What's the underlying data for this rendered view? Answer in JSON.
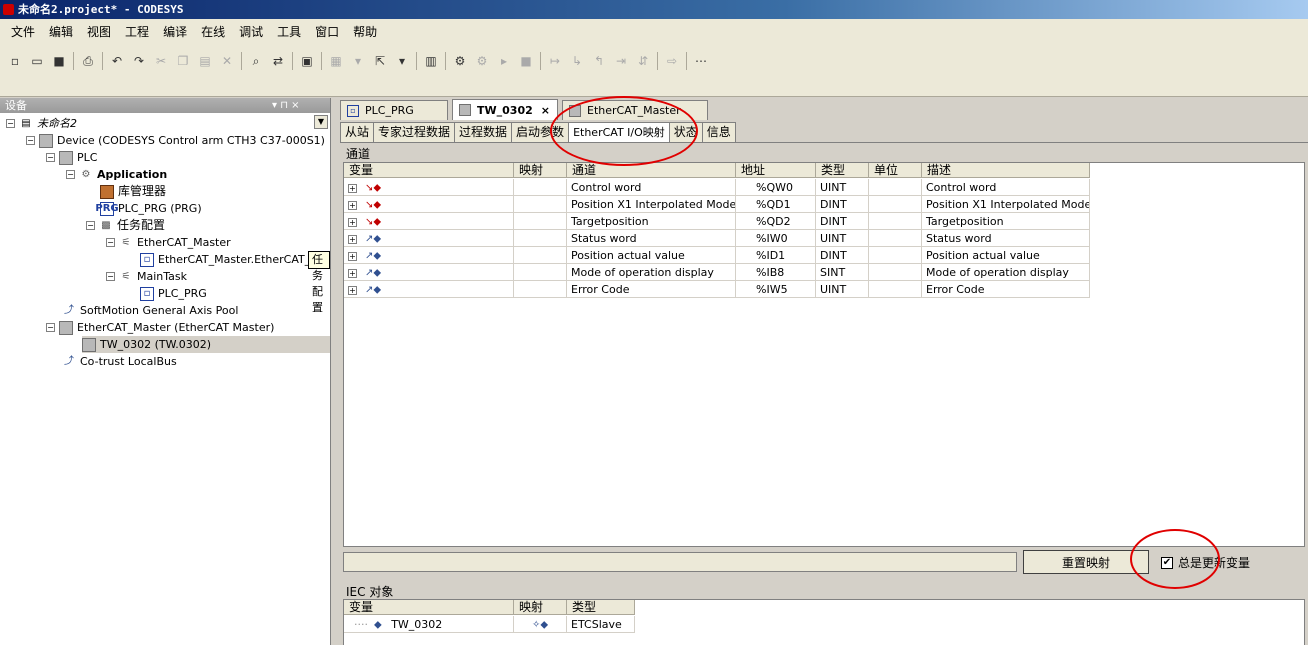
{
  "window": {
    "title": "未命名2.project* - CODESYS"
  },
  "menu": [
    "文件",
    "编辑",
    "视图",
    "工程",
    "编译",
    "在线",
    "调试",
    "工具",
    "窗口",
    "帮助"
  ],
  "device_panel": {
    "title": "设备",
    "pin_label": "▾  ⊓  ×",
    "tooltip": "任务配置",
    "tree": [
      {
        "label": "未命名2",
        "icon": "project-icon"
      },
      {
        "label": "Device (CODESYS Control arm CTH3 C37-000S1)",
        "icon": "device-icon"
      },
      {
        "label": "PLC",
        "icon": "plc-icon"
      },
      {
        "label": "Application",
        "icon": "application-icon"
      },
      {
        "label": "库管理器",
        "icon": "library-icon"
      },
      {
        "label": "PLC_PRG (PRG)",
        "icon": "program-icon"
      },
      {
        "label": "任务配置",
        "icon": "task-config-icon"
      },
      {
        "label": "EtherCAT_Master",
        "icon": "task-icon"
      },
      {
        "label": "EtherCAT_Master.EtherCAT_T",
        "icon": "call-icon"
      },
      {
        "label": "MainTask",
        "icon": "task-icon"
      },
      {
        "label": "PLC_PRG",
        "icon": "call-icon"
      },
      {
        "label": "SoftMotion General Axis Pool",
        "icon": "axis-pool-icon"
      },
      {
        "label": "EtherCAT_Master (EtherCAT Master)",
        "icon": "device-icon"
      },
      {
        "label": "TW_0302 (TW.0302)",
        "icon": "device-icon"
      },
      {
        "label": "Co-trust LocalBus",
        "icon": "axis-pool-icon"
      }
    ]
  },
  "doc_tabs": [
    {
      "label": "PLC_PRG",
      "icon": "program-icon"
    },
    {
      "label": "TW_0302",
      "icon": "device-icon",
      "active": true,
      "close": "×"
    },
    {
      "label": "EtherCAT_Master",
      "icon": "device-icon"
    }
  ],
  "sub_tabs": [
    "从站",
    "专家过程数据",
    "过程数据",
    "启动参数",
    "EtherCAT I/O映射",
    "状态",
    "信息"
  ],
  "channels": {
    "section_label": "通道",
    "columns": [
      "变量",
      "映射",
      "通道",
      "地址",
      "类型",
      "单位",
      "描述"
    ],
    "rows": [
      {
        "dir": "out",
        "channel": "Control word",
        "address": "%QW0",
        "type": "UINT",
        "desc": "Control word"
      },
      {
        "dir": "out",
        "channel": "Position X1 Interpolated Mode",
        "address": "%QD1",
        "type": "DINT",
        "desc": "Position X1 Interpolated Mode"
      },
      {
        "dir": "out",
        "channel": "Targetposition",
        "address": "%QD2",
        "type": "DINT",
        "desc": "Targetposition"
      },
      {
        "dir": "in",
        "channel": "Status word",
        "address": "%IW0",
        "type": "UINT",
        "desc": "Status word"
      },
      {
        "dir": "in",
        "channel": "Position actual value",
        "address": "%ID1",
        "type": "DINT",
        "desc": "Position actual value"
      },
      {
        "dir": "in",
        "channel": "Mode of operation display",
        "address": "%IB8",
        "type": "SINT",
        "desc": "Mode of operation display"
      },
      {
        "dir": "in",
        "channel": "Error Code",
        "address": "%IW5",
        "type": "UINT",
        "desc": "Error Code"
      }
    ]
  },
  "actions": {
    "reset_mapping": "重置映射",
    "always_update": "总是更新变量",
    "always_update_checked": "✔"
  },
  "iec": {
    "section_label": "IEC 对象",
    "columns": [
      "变量",
      "映射",
      "类型"
    ],
    "rows": [
      {
        "variable": "TW_0302",
        "type": "ETCSlave"
      }
    ]
  },
  "colors": {
    "annotation": "#e00000",
    "title_bar": "#0a246a"
  }
}
